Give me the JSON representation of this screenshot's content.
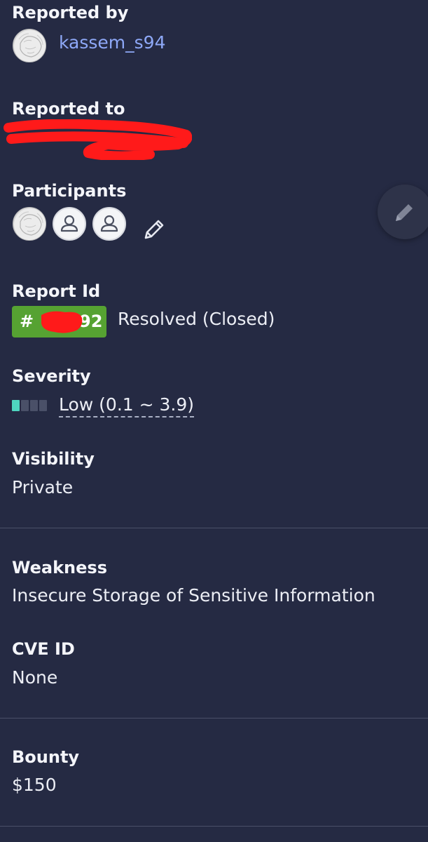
{
  "reported_by": {
    "label": "Reported by",
    "username": "kassem_s94",
    "avatar_icon": "lion-avatar"
  },
  "reported_to": {
    "label": "Reported to"
  },
  "participants": {
    "label": "Participants",
    "avatars": [
      "lion-avatar",
      "user-placeholder-icon",
      "user-placeholder-icon"
    ],
    "edit_icon": "pencil-icon"
  },
  "report_id": {
    "label": "Report Id",
    "badge_prefix": "#",
    "badge_suffix": "92",
    "status": "Resolved (Closed)",
    "badge_color": "#56a232"
  },
  "severity": {
    "label": "Severity",
    "value": "Low (0.1 ~ 3.9)",
    "level": 1,
    "max_level": 4,
    "active_color": "#4fd6c0",
    "inactive_color": "#4a5068"
  },
  "visibility": {
    "label": "Visibility",
    "value": "Private"
  },
  "weakness": {
    "label": "Weakness",
    "value": "Insecure Storage of Sensitive Information"
  },
  "cve": {
    "label": "CVE ID",
    "value": "None"
  },
  "bounty": {
    "label": "Bounty",
    "value": "$150"
  },
  "fab": {
    "icon": "pencil-icon"
  },
  "colors": {
    "background": "#252a43",
    "link": "#8ea8f7",
    "redaction": "#ff1a1a"
  }
}
